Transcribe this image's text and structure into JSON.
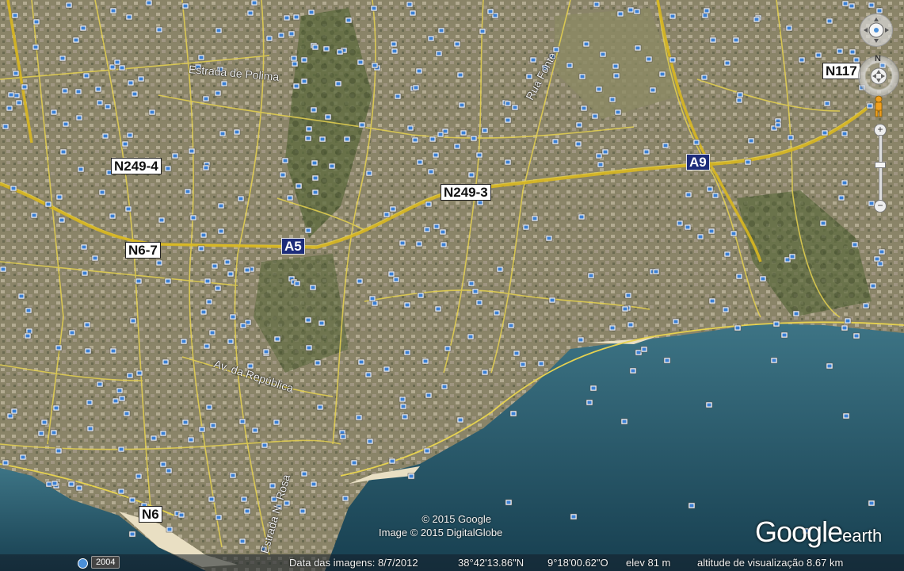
{
  "map": {
    "road_shields": {
      "n249_4": "N249-4",
      "n249_3": "N249-3",
      "n6_7": "N6-7",
      "n6": "N6",
      "n117": "N117"
    },
    "highway_shields": {
      "a5": "A5",
      "a9": "A9"
    },
    "street_names": {
      "estrada_polima": "Estrada de Polima",
      "rua_fonte": "Rua Fonte",
      "av_republica": "Av. da República",
      "estrada_rosa": "Estrada N. Rosa"
    },
    "copyright_line1": "© 2015 Google",
    "copyright_line2": "Image © 2015 DigitalGlobe",
    "logo_text": "Google",
    "logo_suffix": "earth"
  },
  "status_bar": {
    "year": "2004",
    "image_date": "Data das imagens: 8/7/2012",
    "latitude": "38°42'13.86\"N",
    "longitude": "9°18'00.62\"O",
    "elevation": "elev   81 m",
    "eye_altitude": "altitude de visualização   8.67 km"
  },
  "nav_controls": {
    "north_label": "N"
  },
  "colors": {
    "sea_deep": "#1d4a5c",
    "sea_shallow": "#3d7485",
    "land": "#7d7f5c",
    "road": "#e6d250",
    "highway": "#d9b820",
    "beach": "#e9dfc3"
  },
  "icons": {
    "photo_marker": "photo-marker-icon",
    "navigation": "navigation-ring-icon",
    "street_view": "pegman-icon"
  }
}
